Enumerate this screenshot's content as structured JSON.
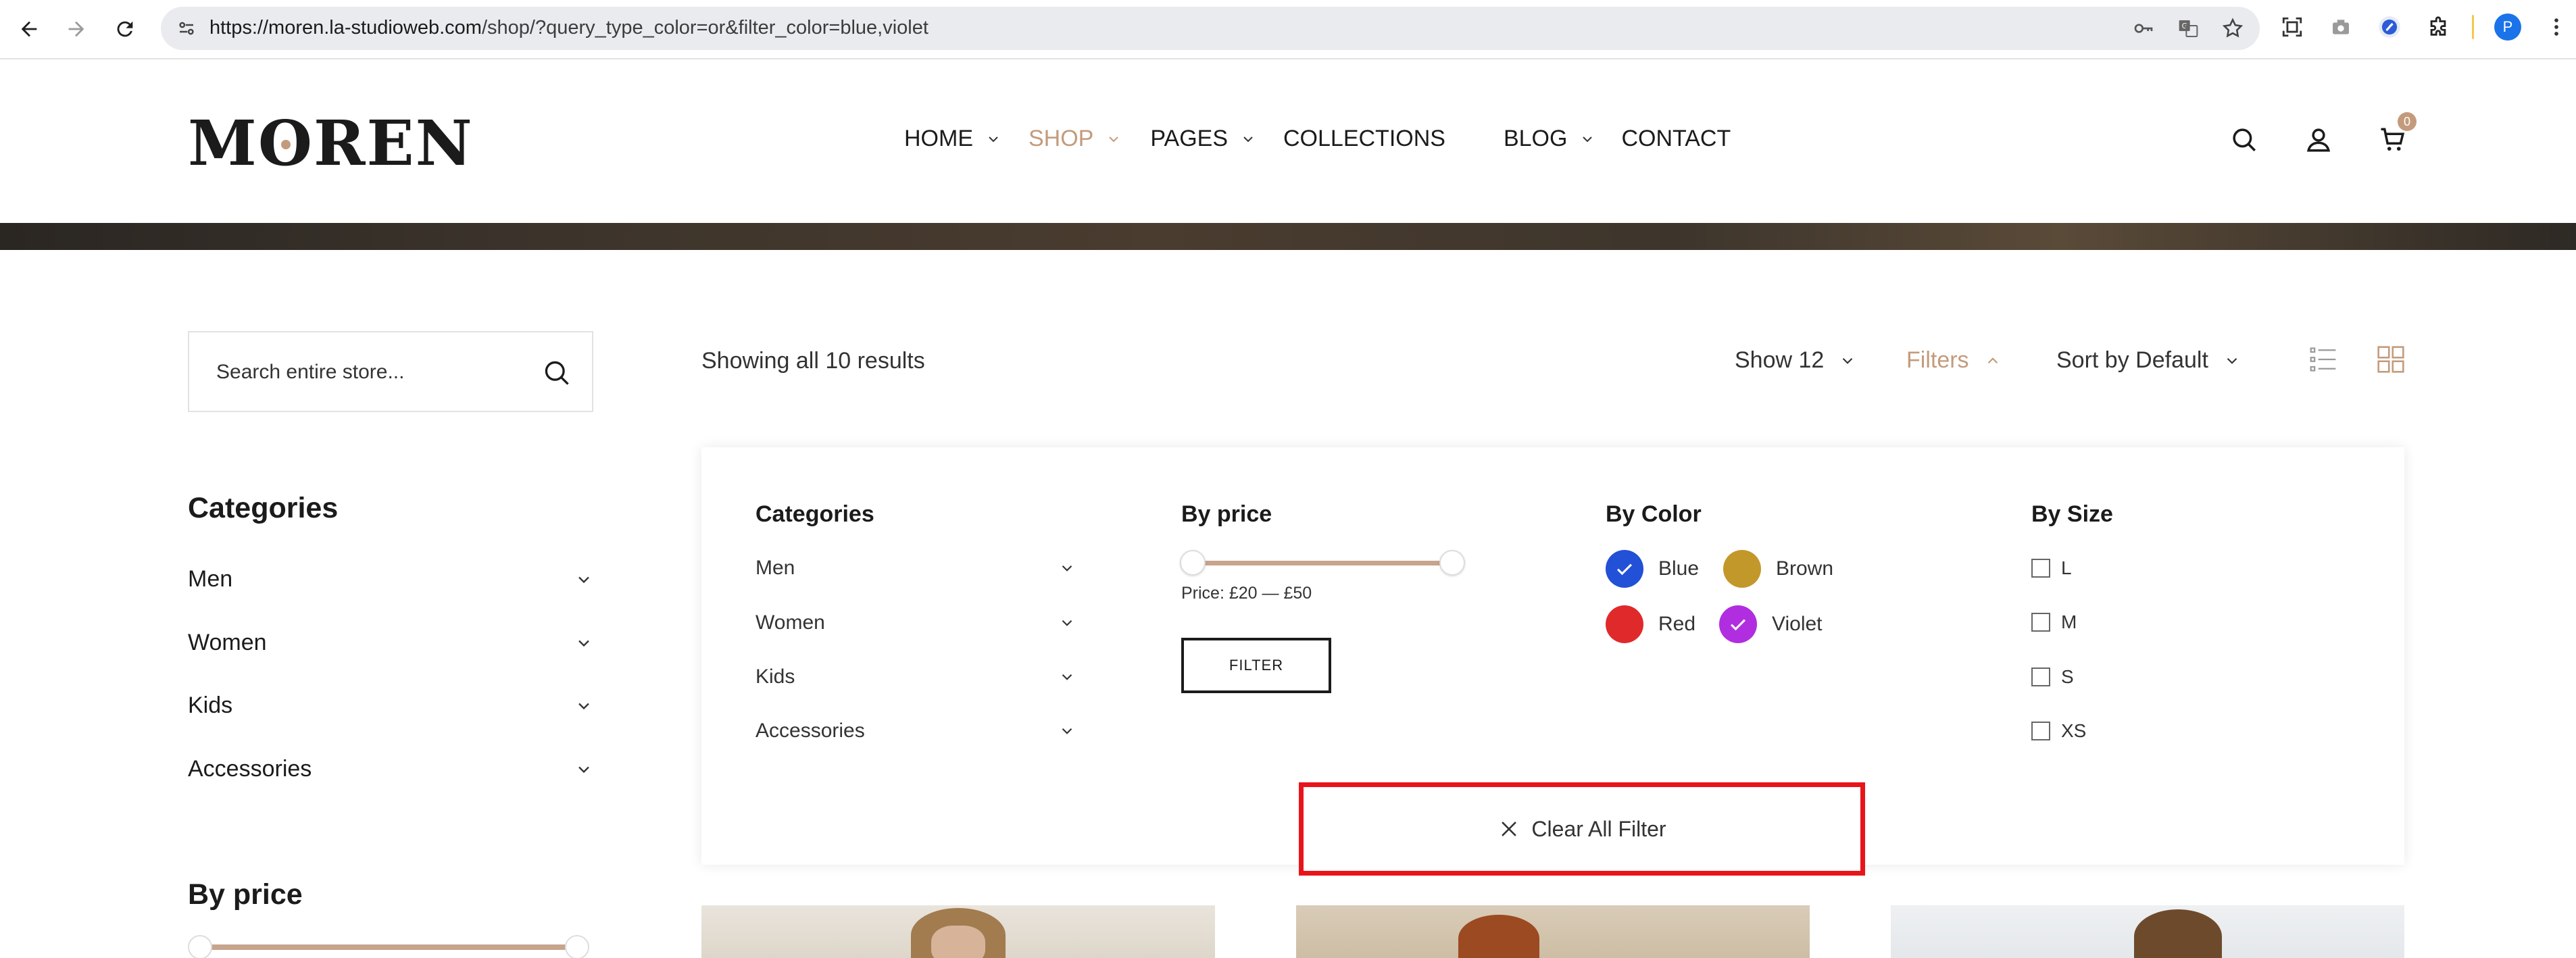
{
  "browser": {
    "url_host": "https://moren.la-studioweb.com",
    "url_path": "/shop/?query_type_color=or&filter_color=blue,violet",
    "profile_initial": "P"
  },
  "header": {
    "logo": "MOREN",
    "nav": [
      {
        "label": "HOME",
        "has_dropdown": true,
        "active": false
      },
      {
        "label": "SHOP",
        "has_dropdown": true,
        "active": true
      },
      {
        "label": "PAGES",
        "has_dropdown": true,
        "active": false
      },
      {
        "label": "COLLECTIONS",
        "has_dropdown": false,
        "active": false
      },
      {
        "label": "BLOG",
        "has_dropdown": true,
        "active": false
      },
      {
        "label": "CONTACT",
        "has_dropdown": false,
        "active": false
      }
    ],
    "cart_count": "0",
    "accent_color": "#c39b7c"
  },
  "sidebar": {
    "search_placeholder": "Search entire store...",
    "categories_title": "Categories",
    "categories": [
      "Men",
      "Women",
      "Kids",
      "Accessories"
    ],
    "price_title": "By price"
  },
  "toolbar": {
    "results": "Showing all 10 results",
    "show": "Show 12",
    "filters": "Filters",
    "sort": "Sort by Default"
  },
  "filter_panel": {
    "categories_title": "Categories",
    "categories": [
      "Men",
      "Women",
      "Kids",
      "Accessories"
    ],
    "price_title": "By price",
    "price_range": "Price: £20 — £50",
    "filter_button": "FILTER",
    "color_title": "By Color",
    "colors": [
      {
        "label": "Blue",
        "hex": "#2250d6",
        "selected": true
      },
      {
        "label": "Brown",
        "hex": "#c3982a",
        "selected": false
      },
      {
        "label": "Red",
        "hex": "#e0292b",
        "selected": false
      },
      {
        "label": "Violet",
        "hex": "#b02ee0",
        "selected": true
      }
    ],
    "size_title": "By Size",
    "sizes": [
      "L",
      "M",
      "S",
      "XS"
    ],
    "clear_all": "Clear All Filter"
  }
}
